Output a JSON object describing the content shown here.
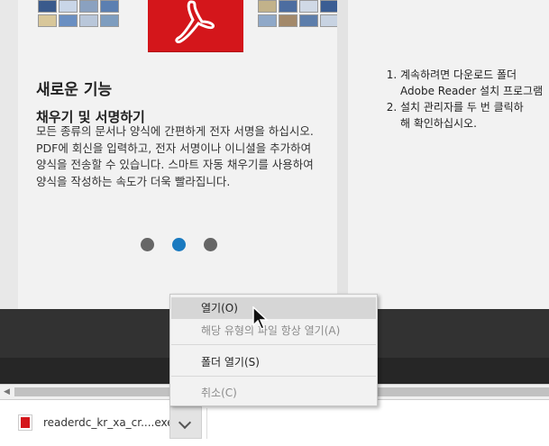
{
  "promo": {
    "heading": "새로운 기능",
    "feature_title": "채우기 및 서명하기",
    "feature_body": "모든 종류의 문서나 양식에 간편하게 전자 서명을 하십시오. PDF에 회신을 입력하고, 전자 서명이나 이니셜을 추가하여 양식을 전송할 수 있습니다. 스마트 자동 채우기를 사용하여 양식을 작성하는 속도가 더욱 빨라집니다.",
    "carousel_active_index": 1,
    "carousel_count": 3
  },
  "instructions": {
    "steps": [
      "계속하려면 다운로드 폴더",
      "Adobe Reader 설치 프로그램",
      "설치 관리자를 두 번 클릭하",
      "해 확인하십시오."
    ]
  },
  "download": {
    "filename": "readerdc_kr_xa_cr....exe",
    "icon": "pdf-file-icon"
  },
  "context_menu": {
    "open": "열기(O)",
    "always_open": "해당 유형의 파일 항상 열기(A)",
    "show_in_folder": "폴더 열기(S)",
    "cancel": "취소(C)"
  },
  "colors": {
    "adobe_red": "#d4161b",
    "carousel_active": "#1a7ac0",
    "carousel_inactive": "#666666"
  }
}
